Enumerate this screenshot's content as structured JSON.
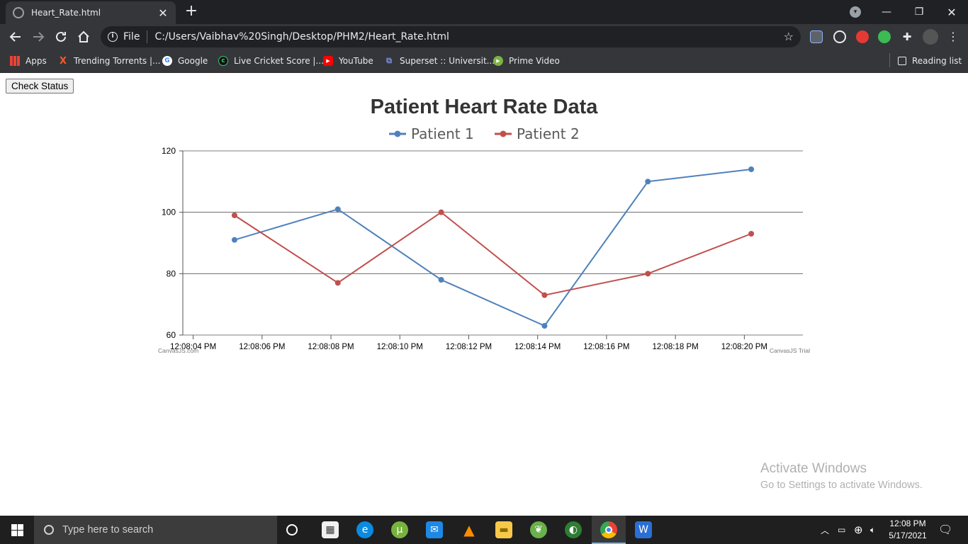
{
  "browser": {
    "tab_title": "Heart_Rate.html",
    "omnibox_scheme_label": "File",
    "url": "C:/Users/Vaibhav%20Singh/Desktop/PHM2/Heart_Rate.html",
    "bookmarks": [
      {
        "label": "Apps",
        "icon": "apps-grid-icon"
      },
      {
        "label": "Trending Torrents |...",
        "icon": "torrent-x-icon"
      },
      {
        "label": "Google",
        "icon": "google-icon"
      },
      {
        "label": "Live Cricket Score |...",
        "icon": "cricket-icon"
      },
      {
        "label": "YouTube",
        "icon": "youtube-icon"
      },
      {
        "label": "Superset :: Universit...",
        "icon": "superset-icon"
      },
      {
        "label": "Prime Video",
        "icon": "prime-video-icon"
      }
    ],
    "reading_list_label": "Reading list"
  },
  "page": {
    "check_status_label": "Check Status",
    "credit_left": "CanvasJS.com",
    "credit_right": "CanvasJS Trial"
  },
  "chart_data": {
    "type": "line",
    "title": "Patient Heart Rate Data",
    "xlabel": "",
    "ylabel": "",
    "x_ticks": [
      "12:08:04 PM",
      "12:08:06 PM",
      "12:08:08 PM",
      "12:08:10 PM",
      "12:08:12 PM",
      "12:08:14 PM",
      "12:08:16 PM",
      "12:08:18 PM",
      "12:08:20 PM"
    ],
    "y_ticks": [
      60,
      80,
      100,
      120
    ],
    "ylim": [
      60,
      120
    ],
    "xlim": [
      "12:08:03.7 PM",
      "12:08:21.7 PM"
    ],
    "grid": true,
    "legend_position": "top-center",
    "series": [
      {
        "name": "Patient 1",
        "color": "#4f81bc",
        "points": [
          {
            "x": "12:08:05.2 PM",
            "y": 91
          },
          {
            "x": "12:08:08.2 PM",
            "y": 101
          },
          {
            "x": "12:08:11.2 PM",
            "y": 78
          },
          {
            "x": "12:08:14.2 PM",
            "y": 63
          },
          {
            "x": "12:08:17.2 PM",
            "y": 110
          },
          {
            "x": "12:08:20.2 PM",
            "y": 114
          }
        ]
      },
      {
        "name": "Patient 2",
        "color": "#c0504e",
        "points": [
          {
            "x": "12:08:05.2 PM",
            "y": 99
          },
          {
            "x": "12:08:08.2 PM",
            "y": 77
          },
          {
            "x": "12:08:11.2 PM",
            "y": 100
          },
          {
            "x": "12:08:14.2 PM",
            "y": 73
          },
          {
            "x": "12:08:17.2 PM",
            "y": 80
          },
          {
            "x": "12:08:20.2 PM",
            "y": 93
          }
        ]
      }
    ]
  },
  "overlay": {
    "activate_title": "Activate Windows",
    "activate_subtitle": "Go to Settings to activate Windows."
  },
  "taskbar": {
    "search_placeholder": "Type here to search",
    "time": "12:08 PM",
    "date": "5/17/2021"
  }
}
